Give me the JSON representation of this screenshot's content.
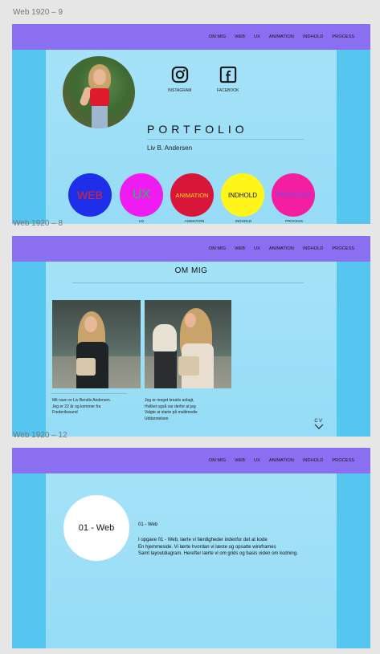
{
  "artboards": {
    "ab9": {
      "label": "Web 1920 – 9",
      "nav": [
        "OM MIG",
        "WEB",
        "UX",
        "ANIMATION",
        "INDHOLD",
        "PROCESS"
      ],
      "social": {
        "instagram": "INSTAGRAM",
        "facebook": "FACEBOOK"
      },
      "title": "PORTFOLIO",
      "name": "Liv B. Andersen",
      "circles": [
        {
          "text": "WEB",
          "caption": "",
          "bg": "#1f2ee8",
          "color": "#e8222c"
        },
        {
          "text": "UX",
          "caption": "UX",
          "bg": "#ee1cf0",
          "color": "#1cc84a"
        },
        {
          "text": "ANIMATION",
          "caption": "ANIMATION",
          "bg": "#d8163a",
          "color": "#f4e21a"
        },
        {
          "text": "INDHOLD",
          "caption": "INDHOLD",
          "bg": "#fff51a",
          "color": "#111111"
        },
        {
          "text": "PROCESS",
          "caption": "PROCESS",
          "bg": "#f31fa0",
          "color": "#6a4cf0"
        }
      ]
    },
    "ab8": {
      "label": "Web 1920 – 8",
      "nav": [
        "OM MIG",
        "WEB",
        "UX",
        "ANIMATION",
        "INDHOLD",
        "PROCESS"
      ],
      "title": "OM MIG",
      "bio_left": [
        "Mit navn er Liv Bendix Andersen.",
        "Jeg er 22 år og kommer fra",
        "Frederikssund"
      ],
      "bio_right": [
        "Jeg er meget kreativ anlagt,",
        "Hvilket også var derfor at jeg",
        "Valgte at starte på multimedie",
        "Uddannelsen"
      ],
      "cv": "CV"
    },
    "ab12": {
      "label": "Web 1920 – 12",
      "nav": [
        "OM MIG",
        "WEB",
        "UX",
        "ANIMATION",
        "INDHOLD",
        "PROCESS"
      ],
      "circle_text": "01 - Web",
      "heading": "01 - Web",
      "description": [
        "I opgave 01 - Web, lærte vi færdigheder indenfor det at kode",
        "En hjemmeside. Vi lærte hvordan vi læste og opsatte wireframes",
        "Samt layoutdiagram. Herefter lærte vi om grids og basis viden om kodning."
      ]
    }
  },
  "colors": {
    "navbar": "#8a6ff0",
    "page_bg": "#8fdaf6",
    "side_bands": "#55c6f0"
  }
}
